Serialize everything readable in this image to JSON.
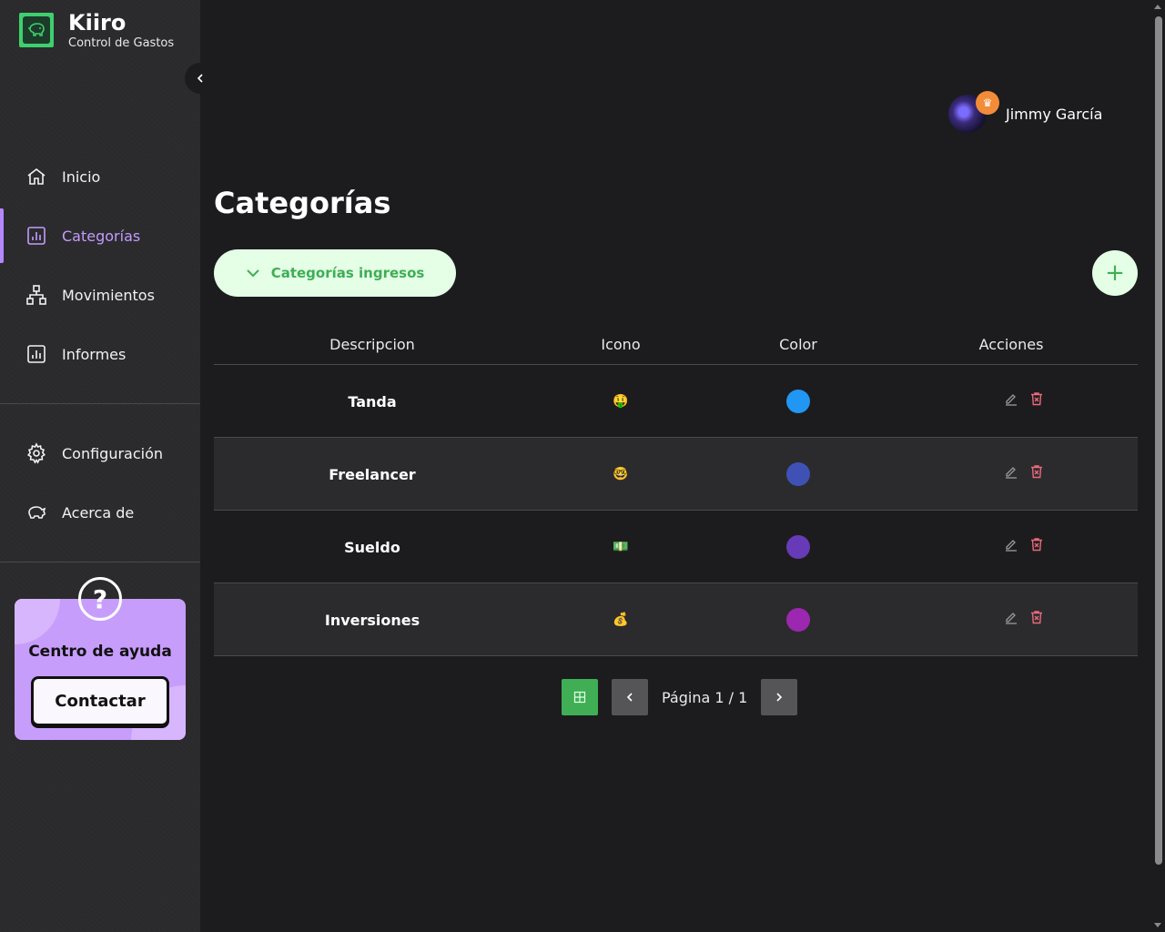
{
  "brand": {
    "title": "Kiiro",
    "subtitle": "Control de Gastos"
  },
  "nav": {
    "items": [
      {
        "label": "Inicio",
        "icon": "home-icon"
      },
      {
        "label": "Categorías",
        "icon": "chart-icon",
        "active": true
      },
      {
        "label": "Movimientos",
        "icon": "hierarchy-icon"
      },
      {
        "label": "Informes",
        "icon": "report-icon"
      }
    ],
    "secondary": [
      {
        "label": "Configuración",
        "icon": "gear-icon"
      },
      {
        "label": "Acerca de",
        "icon": "piggy-icon"
      }
    ]
  },
  "help": {
    "title": "Centro de ayuda",
    "button": "Contactar",
    "symbol": "?"
  },
  "user": {
    "name": "Jimmy García"
  },
  "page": {
    "title": "Categorías"
  },
  "filter": {
    "label": "Categorías ingresos"
  },
  "add_button": {
    "symbol": "+"
  },
  "table": {
    "headers": [
      "Descripcion",
      "Icono",
      "Color",
      "Acciones"
    ],
    "rows": [
      {
        "description": "Tanda",
        "icon": "🤑",
        "color": "#2196f3"
      },
      {
        "description": "Freelancer",
        "icon": "🤓",
        "color": "#3f51b5"
      },
      {
        "description": "Sueldo",
        "icon": "💵",
        "color": "#673ab7"
      },
      {
        "description": "Inversiones",
        "icon": "💰",
        "color": "#9c27b0"
      }
    ]
  },
  "pagination": {
    "text": "Página 1 / 1"
  },
  "colors": {
    "accent": "#3fae55",
    "purple": "#b388ff",
    "delete": "#e86a7a"
  }
}
